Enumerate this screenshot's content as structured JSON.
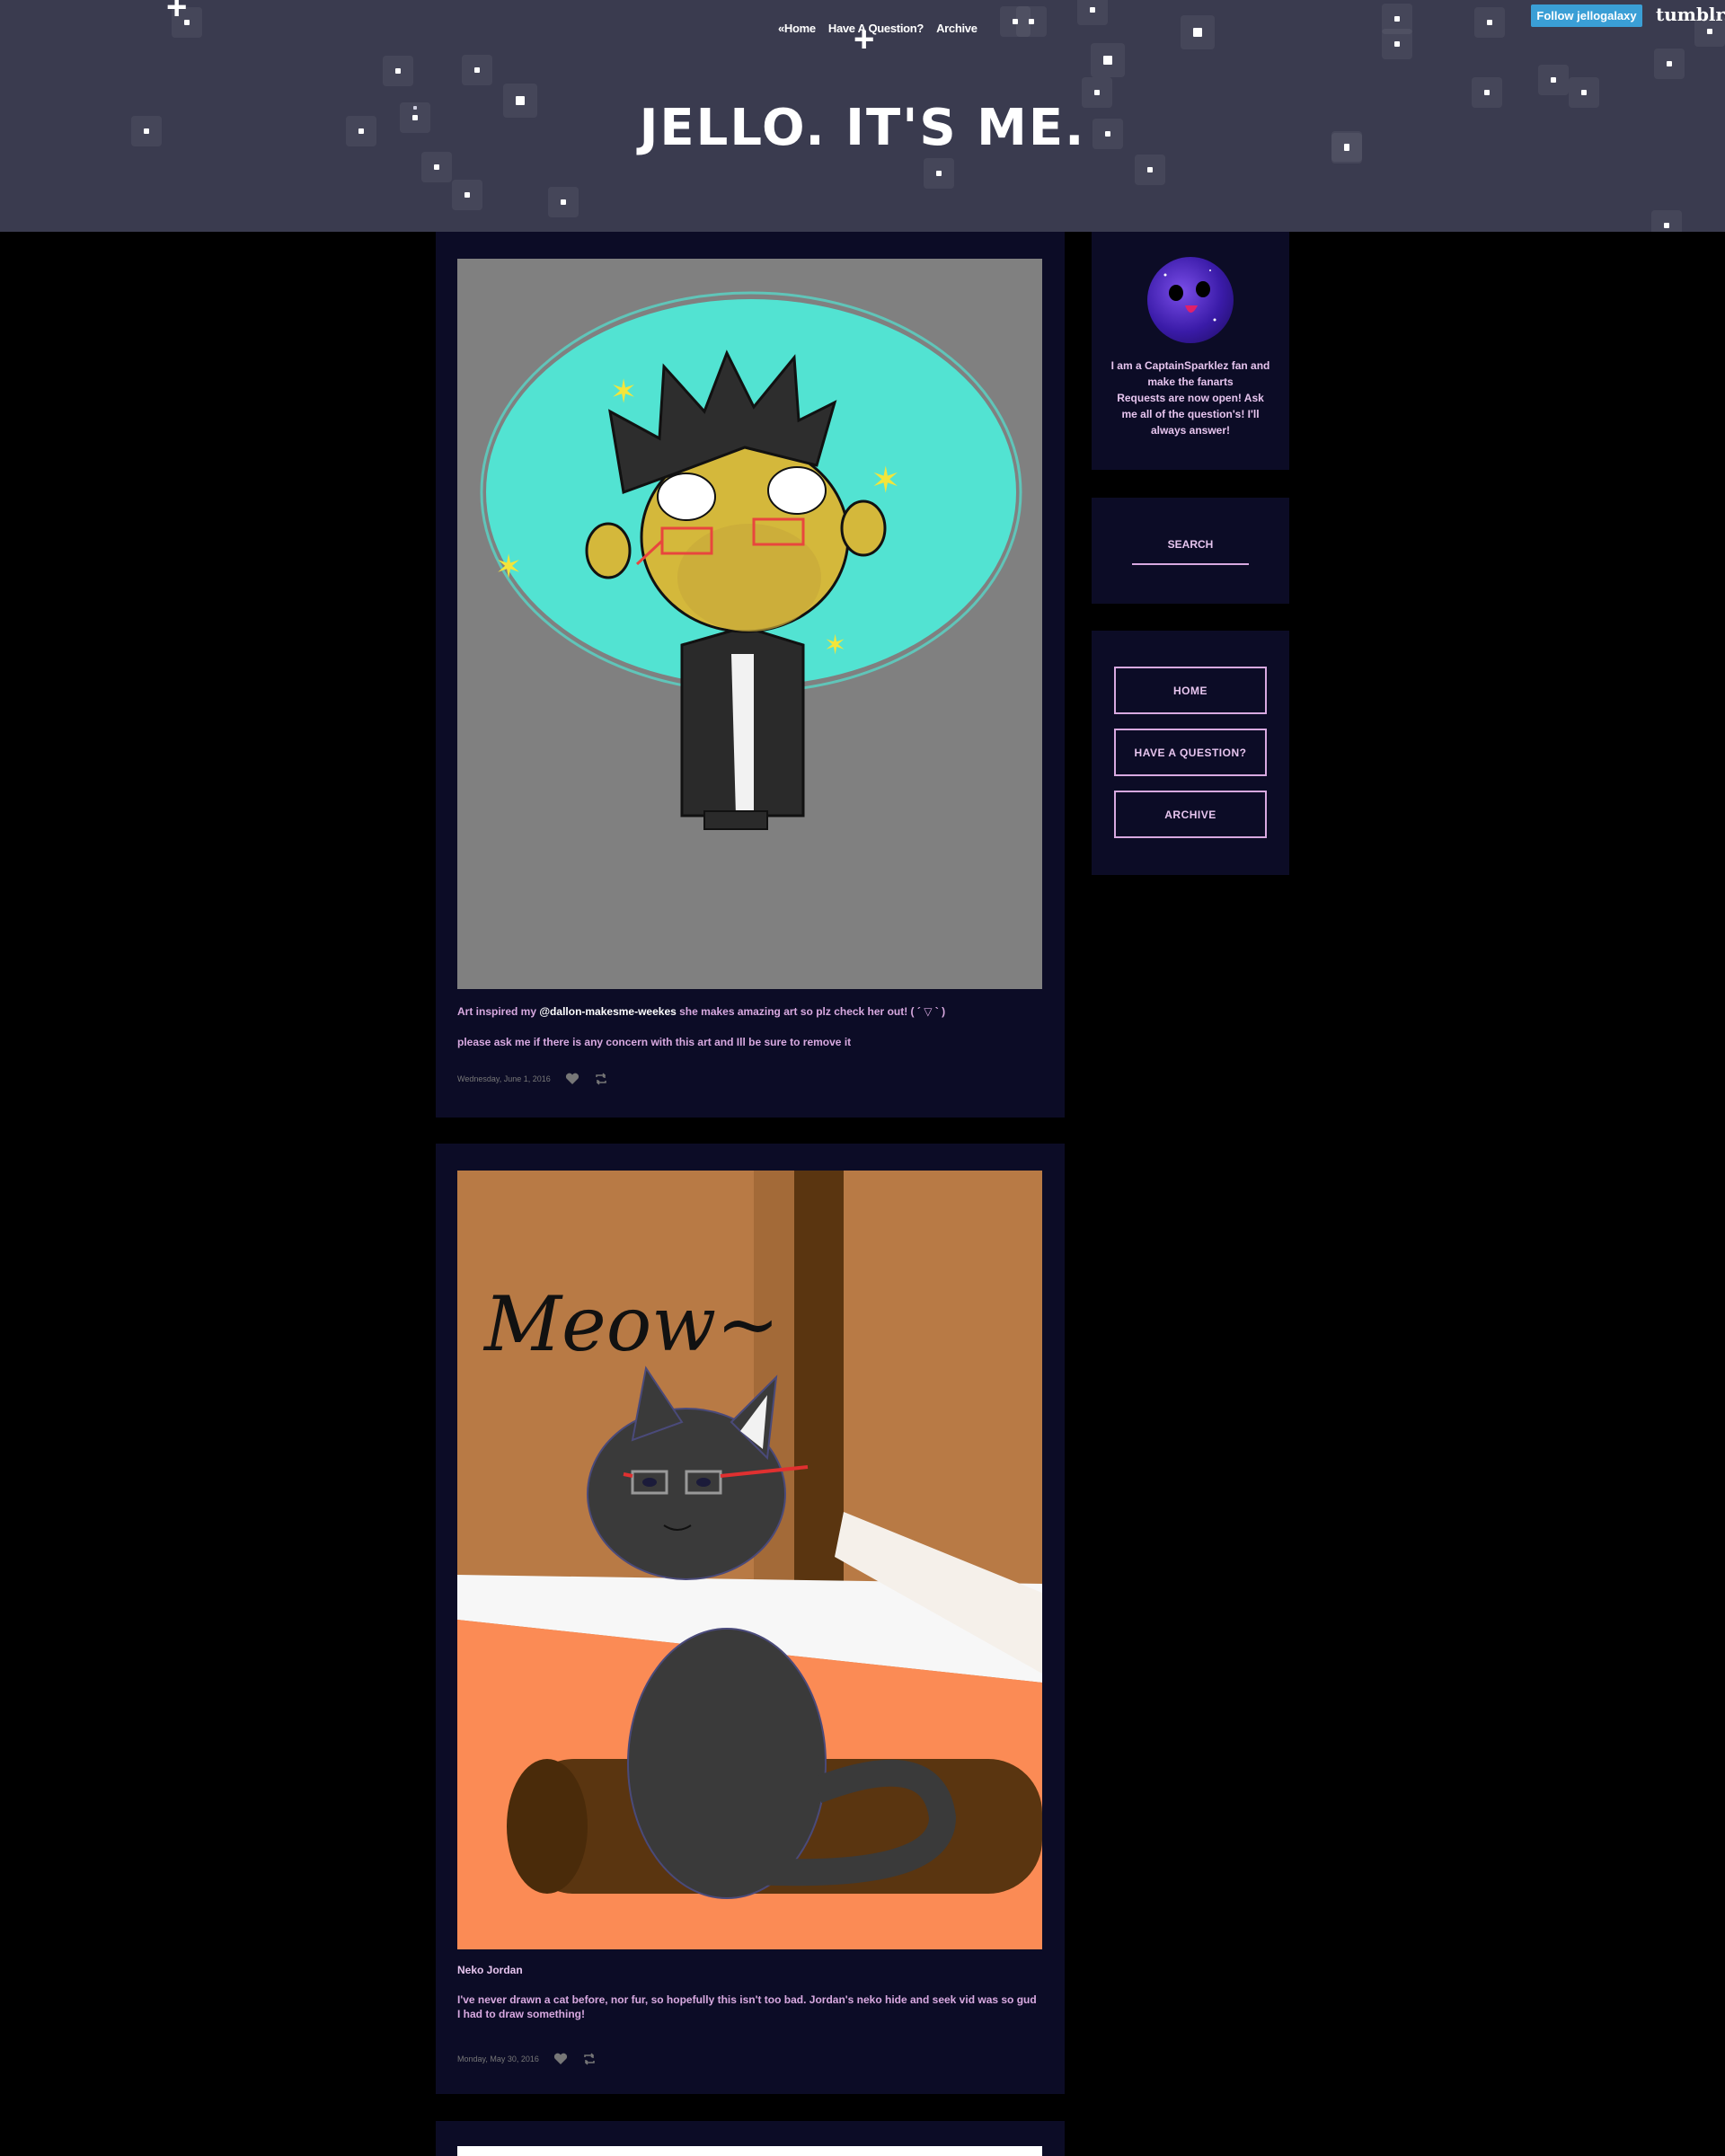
{
  "header": {
    "title": "JELLO. IT'S ME.",
    "nav": [
      "«Home",
      "Have A Question?",
      "Archive"
    ],
    "follow_label": "Follow jellogalaxy",
    "tumblr_logo": "tumblr."
  },
  "posts": [
    {
      "caption_prefix": "Art inspired my ",
      "caption_user": "@dallon-makesme-weekes",
      "caption_suffix": " she makes amazing art so plz check her out! ( ´ ▽ ` )",
      "caption_line2": "please ask me if there is any concern with this art and Ill be sure to remove it",
      "date": "Wednesday, June 1, 2016",
      "image_desc_icon": "fanart-image"
    },
    {
      "image_text": "Meow~",
      "title": "Neko Jordan",
      "caption": "I've never drawn a cat before, nor fur, so hopefully this isn't too bad. Jordan's neko hide and seek vid was so gud I had to draw something!",
      "date": "Monday, May 30, 2016",
      "image_desc_icon": "cat-fanart-image"
    }
  ],
  "sidebar": {
    "bio": "I am a CaptainSparklez fan and make the fanarts\nRequests are now open! Ask me all of the question's! I'll always answer!",
    "search_label": "SEARCH",
    "nav": [
      "HOME",
      "HAVE A QUESTION?",
      "ARCHIVE"
    ]
  },
  "colors": {
    "header_bg": "#3a3b4f",
    "post_bg": "#0c0c26",
    "accent": "#d8a9e0",
    "follow_bg": "#3a9fd6"
  }
}
